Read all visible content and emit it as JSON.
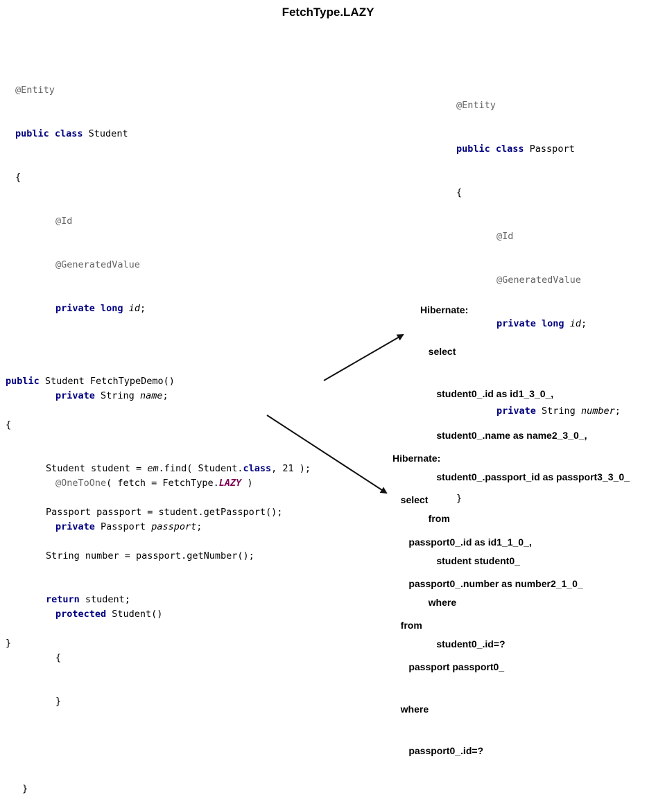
{
  "title": "FetchType.LAZY",
  "student_class": {
    "entity": "@Entity",
    "decl_kw": "public class",
    "name": " Student",
    "open": "{",
    "id_ann": "@Id",
    "gen_ann": "@GeneratedValue",
    "id_kw": "private long",
    "id_field": "id",
    "semi": ";",
    "name_kw": "private",
    "name_type": " String ",
    "name_field": "name",
    "o2o_ann": "@OneToOne",
    "o2o_args_pre": "( fetch = FetchType.",
    "o2o_lazy": "LAZY",
    "o2o_args_post": " )",
    "passport_kw": "private",
    "passport_type": " Passport ",
    "passport_field": "passport",
    "ctor_kw": "protected",
    "ctor_name": " Student()",
    "ctor_open": "{",
    "ctor_close": "}",
    "close": "}"
  },
  "passport_class": {
    "entity": "@Entity",
    "decl_kw": "public class",
    "name": " Passport",
    "open": "{",
    "id_ann": "@Id",
    "gen_ann": "@GeneratedValue",
    "id_kw": "private long",
    "id_field": "id",
    "semi": ";",
    "num_kw": "private",
    "num_type": " String ",
    "num_field": "number",
    "close": "}"
  },
  "demo_method": {
    "sig_kw": "public",
    "sig_rest": " Student FetchTypeDemo()",
    "open": "{",
    "l1_pre": "Student student = ",
    "l1_em": "em",
    "l1_mid": ".find( Student.",
    "l1_class": "class",
    "l1_post": ", 21 );",
    "l2": "Passport passport = student.getPassport();",
    "l3": "String number = passport.getNumber();",
    "l4_kw": "return",
    "l4_rest": " student;",
    "close": "}"
  },
  "sql_student": [
    "Hibernate:",
    "   select",
    "      student0_.id as id1_3_0_,",
    "      student0_.name as name2_3_0_,",
    "      student0_.passport_id as passport3_3_0_",
    "   from",
    "      student student0_",
    "   where",
    "      student0_.id=?"
  ],
  "sql_passport": [
    "Hibernate:",
    "   select",
    "      passport0_.id as id1_1_0_,",
    "      passport0_.number as number2_1_0_",
    "   from",
    "      passport passport0_",
    "   where",
    "      passport0_.id=?"
  ]
}
